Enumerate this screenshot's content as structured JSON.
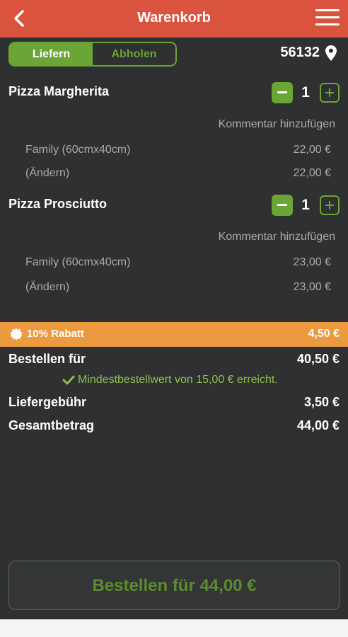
{
  "header": {
    "title": "Warenkorb",
    "back_icon": "back-chevron-icon",
    "menu_icon": "hamburger-menu-icon"
  },
  "delivery_toggle": {
    "options": [
      "Liefern",
      "Abholen"
    ],
    "selected": "Liefern"
  },
  "location": {
    "zip": "56132",
    "icon": "location-pin-icon"
  },
  "items": [
    {
      "name": "Pizza Margherita",
      "quantity": "1",
      "comment_label": "Kommentar hinzufügen",
      "options": [
        {
          "label": "Family (60cmx40cm)",
          "price": "22,00 €"
        },
        {
          "label": "(Ändern)",
          "price": "22,00 €"
        }
      ]
    },
    {
      "name": "Pizza Prosciutto",
      "quantity": "1",
      "comment_label": "Kommentar hinzufügen",
      "options": [
        {
          "label": "Family (60cmx40cm)",
          "price": "23,00 €"
        },
        {
          "label": "(Ändern)",
          "price": "23,00 €"
        }
      ]
    }
  ],
  "discount": {
    "label": "10% Rabatt",
    "value": "4,50 €",
    "icon": "badge-icon"
  },
  "summary": {
    "order_for_label": "Bestellen für",
    "order_for_value": "40,50 €",
    "min_order_message": "Mindestbestellwert von 15,00 € erreicht.",
    "delivery_fee_label": "Liefergebühr",
    "delivery_fee_value": "3,50 €",
    "total_label": "Gesamtbetrag",
    "total_value": "44,00 €"
  },
  "order_button": {
    "label": "Bestellen für 44,00 €"
  },
  "colors": {
    "header": "#d9533e",
    "background": "#2e3031",
    "accent_green": "#6aa535",
    "discount_bar": "#ec9a3f"
  }
}
